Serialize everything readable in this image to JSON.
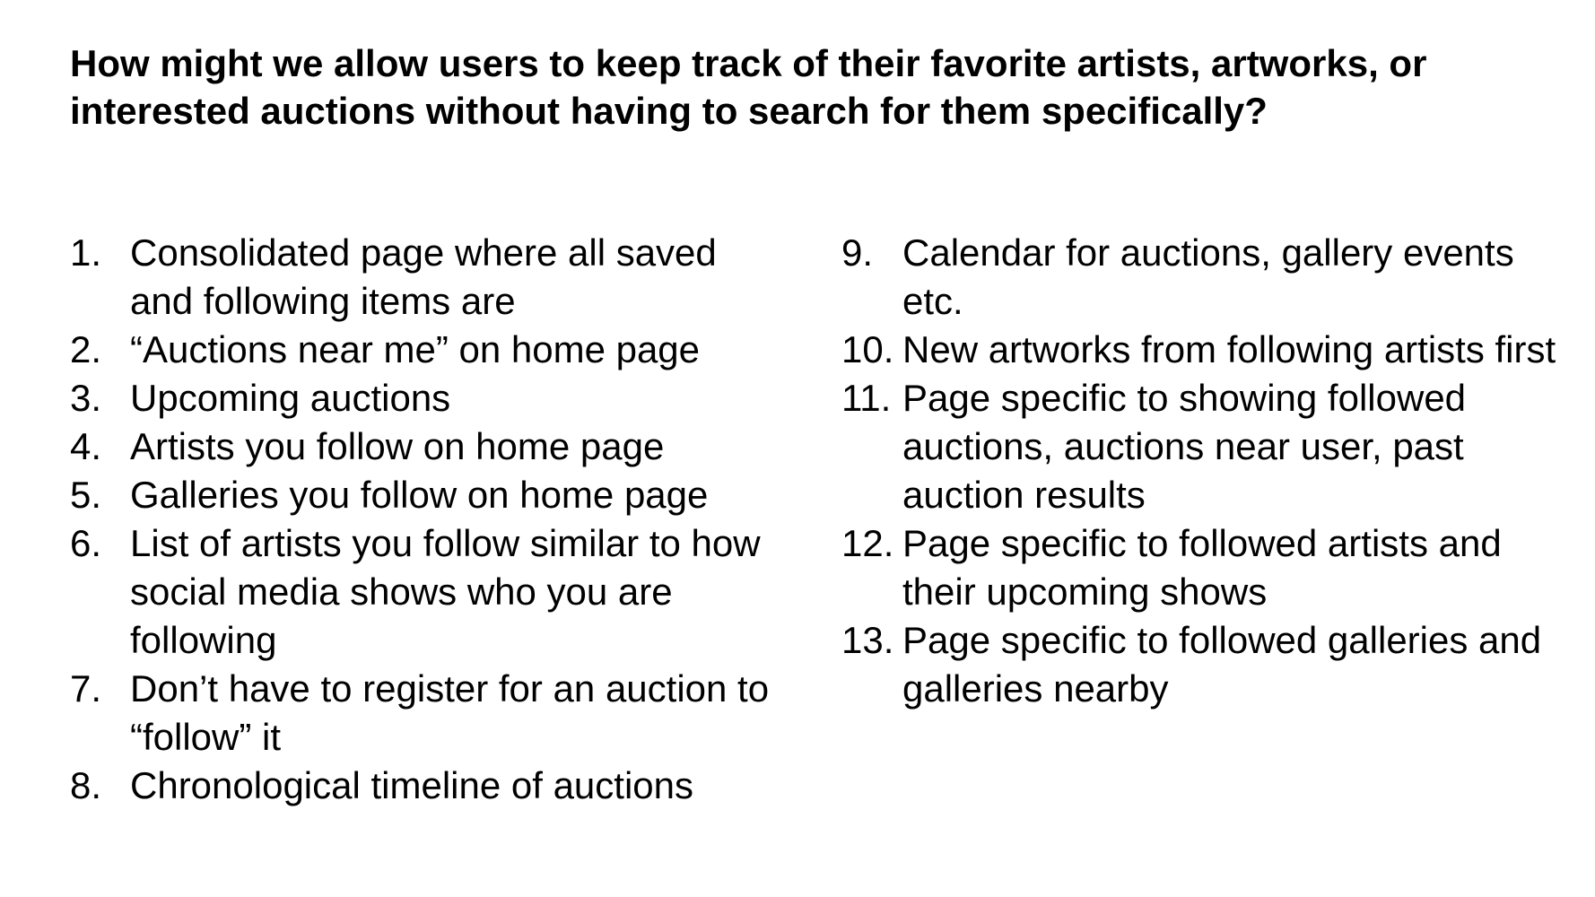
{
  "heading": "How might we allow users to keep track of their favorite artists, artworks, or interested auctions without having to search for them specifically?",
  "left_items": [
    {
      "num": "1.",
      "text": "Consolidated page where all saved and following items are"
    },
    {
      "num": "2.",
      "text": "“Auctions near me” on home page"
    },
    {
      "num": "3.",
      "text": "Upcoming auctions"
    },
    {
      "num": "4.",
      "text": "Artists you follow on home page"
    },
    {
      "num": "5.",
      "text": "Galleries you follow on home page"
    },
    {
      "num": "6.",
      "text": "List of artists you follow similar to how social media shows who you are following"
    },
    {
      "num": "7.",
      "text": "Don’t have to register for an auction to “follow” it"
    },
    {
      "num": "8.",
      "text": "Chronological timeline of auctions"
    }
  ],
  "right_items": [
    {
      "num": "9.",
      "text": "Calendar for auctions, gallery events etc."
    },
    {
      "num": "10.",
      "text": "New artworks from following artists first"
    },
    {
      "num": "11.",
      "text": "Page specific to showing followed auctions, auctions near user, past auction results"
    },
    {
      "num": "12.",
      "text": "Page specific to followed artists and their upcoming shows"
    },
    {
      "num": "13.",
      "text": "Page specific to followed galleries and galleries nearby"
    }
  ]
}
